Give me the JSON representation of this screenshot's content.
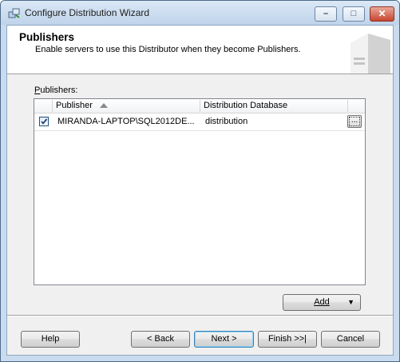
{
  "window": {
    "title": "Configure Distribution Wizard",
    "caption_buttons": {
      "minimize": "–",
      "maximize": "□",
      "close": "✕"
    }
  },
  "header": {
    "title": "Publishers",
    "subtitle": "Enable servers to use this Distributor when they become Publishers."
  },
  "publishers": {
    "label": "Publishers:",
    "columns": [
      "Publisher",
      "Distribution Database"
    ],
    "sort": {
      "column": "Publisher",
      "direction": "ascending"
    },
    "rows": [
      {
        "checked": true,
        "publisher": "MIRANDA-LAPTOP\\SQL2012DE...",
        "distribution_database": "distribution",
        "ellipsis_label": "..."
      }
    ]
  },
  "add_button": {
    "label": "Add",
    "arrow": "▼"
  },
  "footer": {
    "help": "Help",
    "back": "< Back",
    "next": "Next >",
    "finish": "Finish >>|",
    "cancel": "Cancel"
  },
  "icons": {
    "app": "wizard-app-icon",
    "header_art": "server-tower-icon",
    "sort": "sort-ascending-icon",
    "check": "checkmark-icon"
  }
}
